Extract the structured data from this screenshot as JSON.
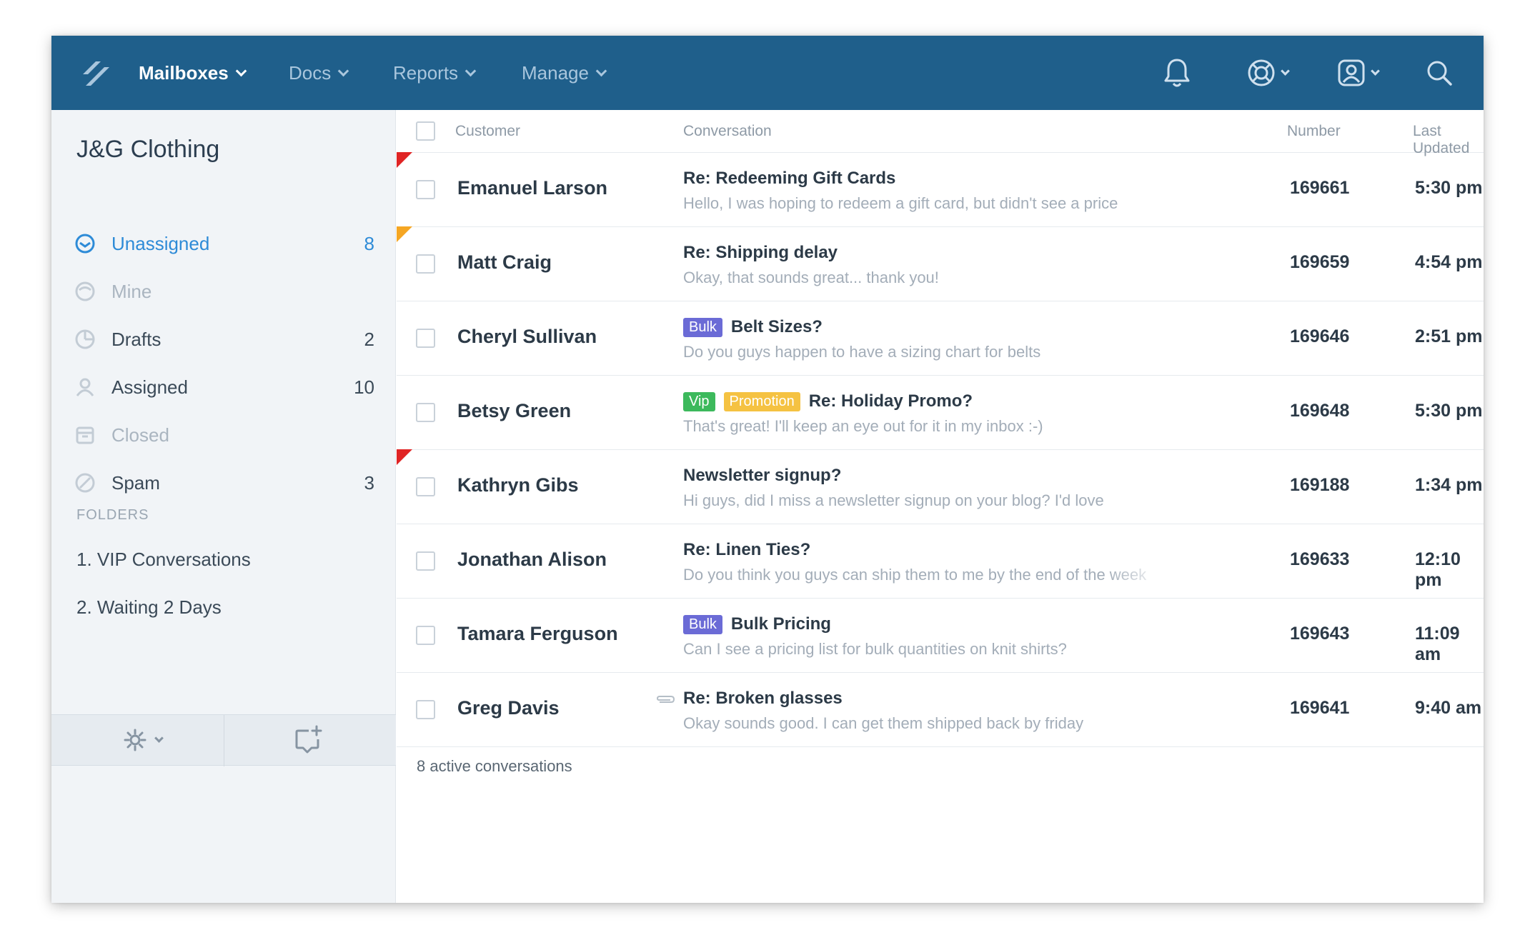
{
  "topbar": {
    "nav": [
      {
        "label": "Mailboxes",
        "active": true
      },
      {
        "label": "Docs",
        "active": false
      },
      {
        "label": "Reports",
        "active": false
      },
      {
        "label": "Manage",
        "active": false
      }
    ],
    "icons": [
      "bell-icon",
      "lifebuoy-icon",
      "user-profile-icon",
      "search-icon"
    ]
  },
  "sidebar": {
    "brand": "J&G Clothing",
    "items": [
      {
        "label": "Unassigned",
        "count": "8",
        "icon": "inbox-icon",
        "state": "active"
      },
      {
        "label": "Mine",
        "count": "",
        "icon": "mine-icon",
        "state": "muted"
      },
      {
        "label": "Drafts",
        "count": "2",
        "icon": "drafts-icon",
        "state": "normal"
      },
      {
        "label": "Assigned",
        "count": "10",
        "icon": "user-icon",
        "state": "normal"
      },
      {
        "label": "Closed",
        "count": "",
        "icon": "archive-icon",
        "state": "muted"
      },
      {
        "label": "Spam",
        "count": "3",
        "icon": "spam-icon",
        "state": "normal"
      }
    ],
    "folders_heading": "FOLDERS",
    "folders": [
      "1. VIP Conversations",
      "2. Waiting 2 Days"
    ]
  },
  "table": {
    "headers": {
      "customer": "Customer",
      "conversation": "Conversation",
      "number": "Number",
      "updated": "Last Updated"
    },
    "rows": [
      {
        "customer": "Emanuel Larson",
        "tags": [],
        "subject": "Re: Redeeming Gift Cards",
        "preview": "Hello, I was hoping to redeem a gift card, but didn't see a price",
        "number": "169661",
        "time": "5:30 pm",
        "flag": "red"
      },
      {
        "customer": "Matt Craig",
        "tags": [],
        "subject": "Re: Shipping delay",
        "preview": "Okay, that sounds great... thank you!",
        "number": "169659",
        "time": "4:54 pm",
        "flag": "orange"
      },
      {
        "customer": "Cheryl Sullivan",
        "tags": [
          {
            "label": "Bulk",
            "kind": "bulk"
          }
        ],
        "subject": "Belt Sizes?",
        "preview": "Do you guys happen to have a sizing chart for belts",
        "number": "169646",
        "time": "2:51 pm",
        "flag": ""
      },
      {
        "customer": "Betsy Green",
        "tags": [
          {
            "label": "Vip",
            "kind": "vip"
          },
          {
            "label": "Promotion",
            "kind": "promo"
          }
        ],
        "subject": "Re: Holiday Promo?",
        "preview": "That's great! I'll keep an eye out for it in my inbox :-)",
        "number": "169648",
        "time": "5:30 pm",
        "flag": ""
      },
      {
        "customer": "Kathryn Gibs",
        "tags": [],
        "subject": "Newsletter signup?",
        "preview": "Hi guys, did I miss a newsletter signup on your blog? I'd love",
        "number": "169188",
        "time": "1:34 pm",
        "flag": "red"
      },
      {
        "customer": "Jonathan Alison",
        "tags": [],
        "subject": "Re: Linen Ties?",
        "preview": "Do you think you guys can ship them to me by the end of the week",
        "number": "169633",
        "time": "12:10 pm",
        "flag": ""
      },
      {
        "customer": "Tamara Ferguson",
        "tags": [
          {
            "label": "Bulk",
            "kind": "bulk"
          }
        ],
        "subject": "Bulk Pricing",
        "preview": "Can I see a pricing list for bulk quantities on knit shirts?",
        "number": "169643",
        "time": "11:09 am",
        "flag": ""
      },
      {
        "customer": "Greg Davis",
        "tags": [],
        "subject": "Re: Broken glasses",
        "preview": "Okay sounds good. I can get them shipped back by friday",
        "number": "169641",
        "time": "9:40 am",
        "flag": "",
        "attachment": true
      }
    ],
    "footer": "8 active conversations"
  }
}
